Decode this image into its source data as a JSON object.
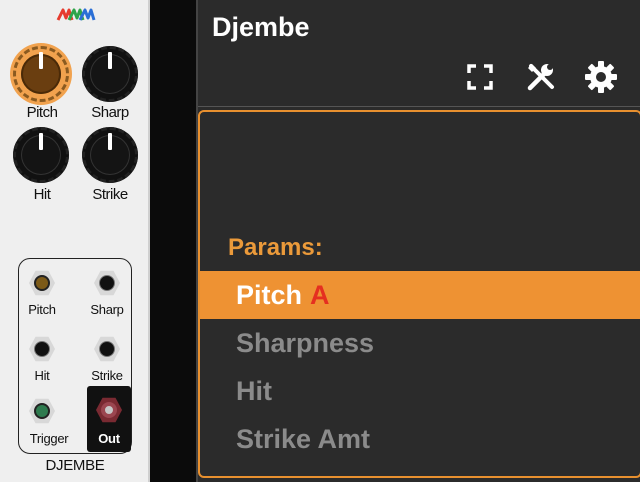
{
  "module": {
    "name": "DJEMBE",
    "logo_colors": [
      "#e63b2e",
      "#2fa44a",
      "#2b6fd6"
    ],
    "knobs": [
      {
        "label": "Pitch",
        "selected": true
      },
      {
        "label": "Sharp",
        "selected": false
      },
      {
        "label": "Hit",
        "selected": false
      },
      {
        "label": "Strike",
        "selected": false
      }
    ],
    "jacks": [
      {
        "label": "Pitch",
        "style": "gold"
      },
      {
        "label": "Sharp",
        "style": "dark"
      },
      {
        "label": "Hit",
        "style": "dark"
      },
      {
        "label": "Strike",
        "style": "dark"
      },
      {
        "label": "Trigger",
        "style": "green"
      },
      {
        "label": "Out",
        "style": "red-output"
      }
    ]
  },
  "pane": {
    "title": "Djembe",
    "toolbar": {
      "icons": [
        "fullscreen-icon",
        "tools-icon",
        "settings-gear-icon"
      ]
    },
    "params_label": "Params:",
    "params": [
      {
        "label": "Pitch",
        "tag": "A",
        "active": true
      },
      {
        "label": "Sharpness",
        "tag": "",
        "active": false
      },
      {
        "label": "Hit",
        "tag": "",
        "active": false
      },
      {
        "label": "Strike Amt",
        "tag": "",
        "active": false
      }
    ],
    "colors": {
      "accent": "#ee9233",
      "tag": "#e52f20",
      "inactive_text": "#8b8b8b",
      "background": "#2b2b2b"
    }
  }
}
